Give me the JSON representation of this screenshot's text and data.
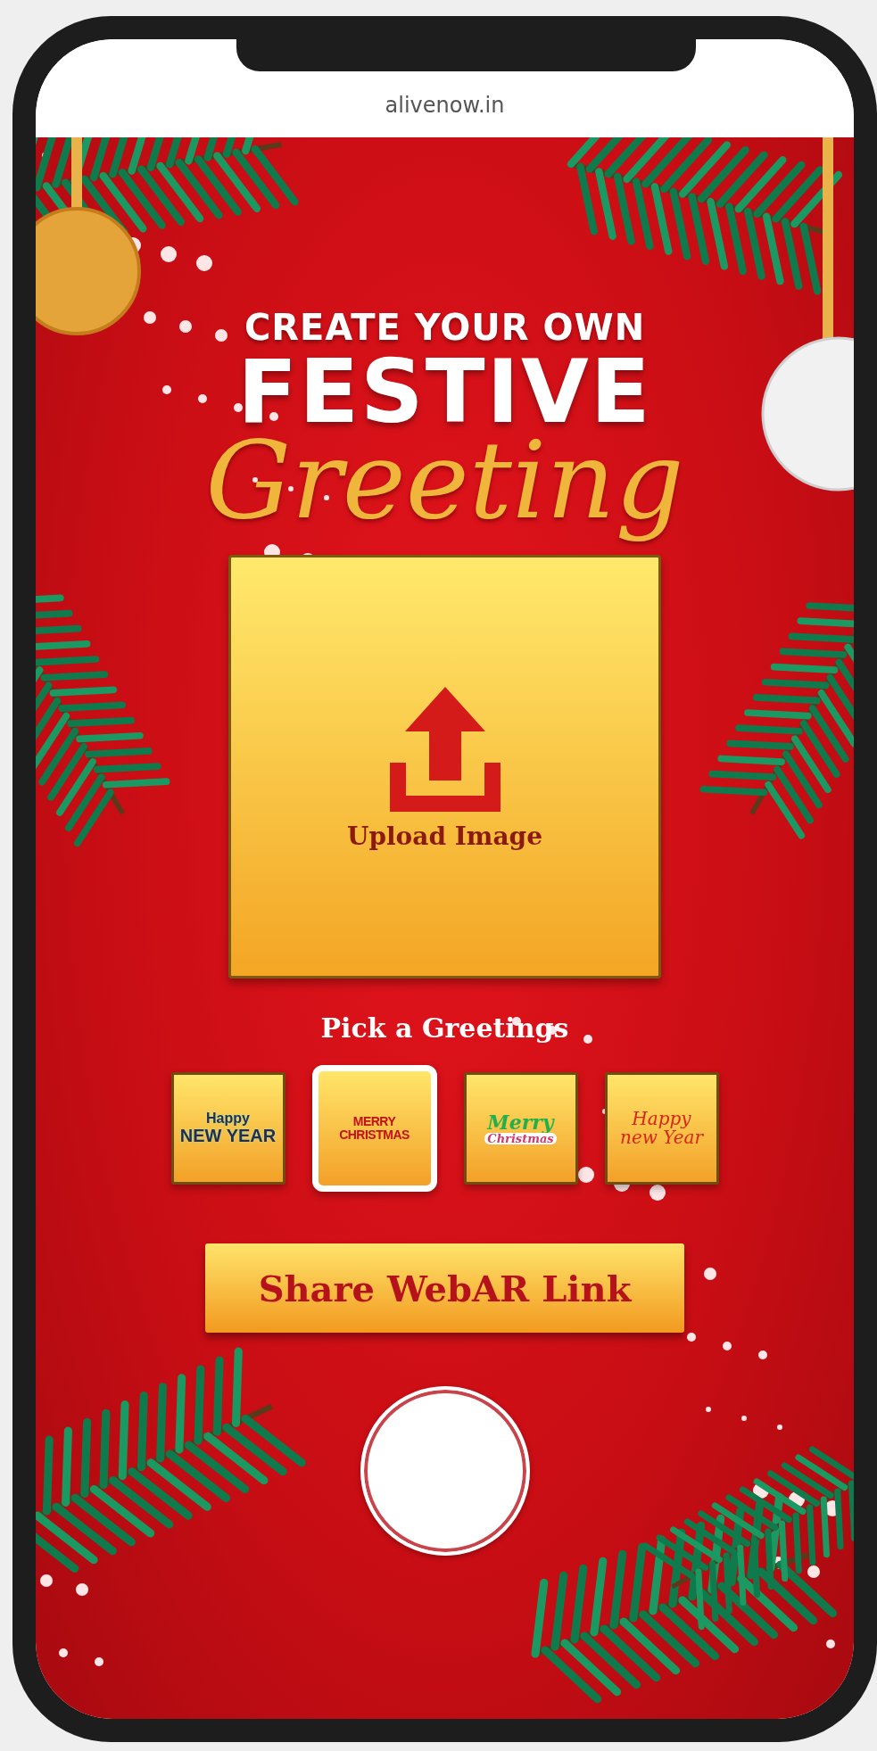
{
  "browser": {
    "url": "alivenow.in"
  },
  "page": {
    "heading_small": "CREATE YOUR OWN",
    "heading_large": "FESTIVE",
    "heading_script": "Greeting",
    "upload": {
      "label": "Upload Image"
    },
    "greetings_label": "Pick a Greetings",
    "greetings": [
      {
        "kind": "balloons",
        "lines": [
          "Happy",
          "NEW YEAR"
        ],
        "selected": false
      },
      {
        "kind": "block",
        "lines": [
          "MERRY",
          "CHRISTMAS"
        ],
        "selected": true
      },
      {
        "kind": "script",
        "lines": [
          "Merry",
          "Christmas"
        ],
        "selected": false
      },
      {
        "kind": "circle",
        "lines": [
          "Happy",
          "new Year"
        ],
        "selected": false
      }
    ],
    "share_button": "Share WebAR Link"
  }
}
